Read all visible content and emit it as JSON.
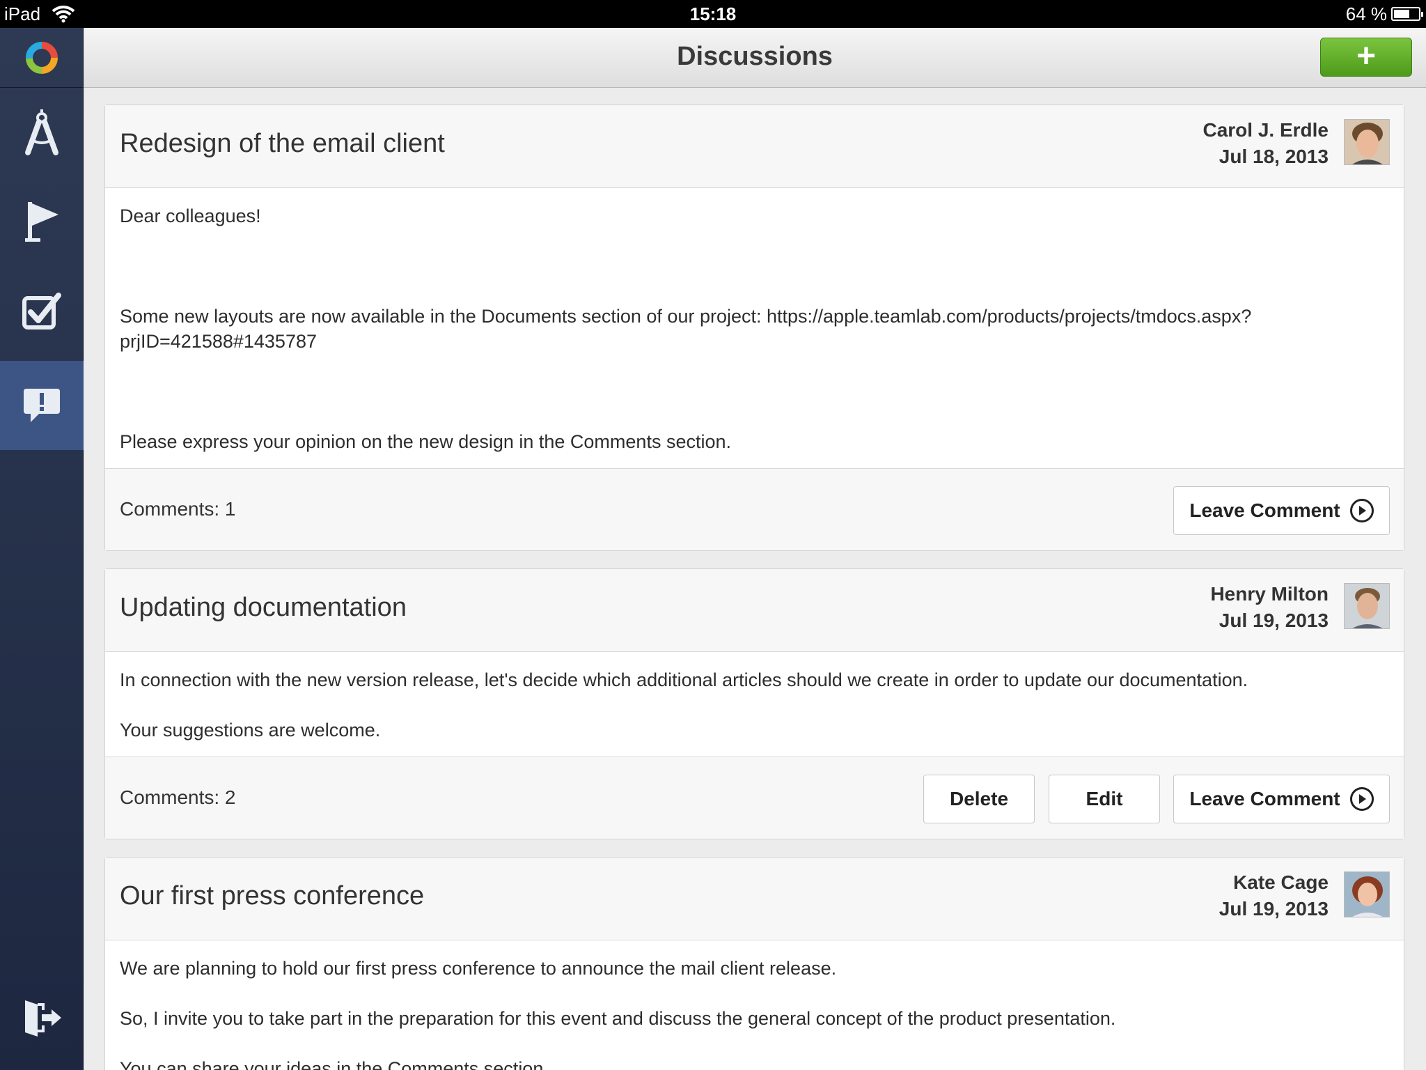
{
  "status_bar": {
    "device": "iPad",
    "time": "15:18",
    "battery_text": "64 %",
    "battery_level": 0.64
  },
  "sidebar": {
    "items": [
      {
        "icon": "compass-icon",
        "active": false
      },
      {
        "icon": "flag-icon",
        "active": false
      },
      {
        "icon": "checkbox-icon",
        "active": false
      },
      {
        "icon": "discussion-alert-icon",
        "active": true
      }
    ],
    "logout_icon": "logout-icon"
  },
  "header": {
    "title": "Discussions",
    "add_label": "+"
  },
  "colors": {
    "sidebar": "#2a3550",
    "sidebar_active": "#3c5584",
    "add_button": "#5fae27"
  },
  "discussions": [
    {
      "title": "Redesign of the email client",
      "author": "Carol J. Erdle",
      "date": "Jul 18, 2013",
      "body": [
        "Dear colleagues!",
        "Some new layouts are now available in the Documents section of our project: https://apple.teamlab.com/products/projects/tmdocs.aspx?prjID=421588#1435787",
        "Please express your opinion on the new design in the Comments section."
      ],
      "comments": "Comments: 1",
      "leave_comment": "Leave Comment"
    },
    {
      "title": "Updating documentation",
      "author": "Henry Milton",
      "date": "Jul 19, 2013",
      "body": [
        "In connection with the new version release, let's decide which additional articles should we create in order to update our documentation.",
        "Your suggestions are welcome."
      ],
      "comments": "Comments: 2",
      "delete": "Delete",
      "edit": "Edit",
      "leave_comment": "Leave Comment"
    },
    {
      "title": "Our first press conference",
      "author": "Kate Cage",
      "date": "Jul 19, 2013",
      "body": [
        "We are planning to hold our first press conference to announce the mail client release.",
        "So, I invite you to take part in the preparation for this event and discuss the general concept of the product presentation.",
        "You can share your ideas in the Comments section."
      ]
    }
  ]
}
